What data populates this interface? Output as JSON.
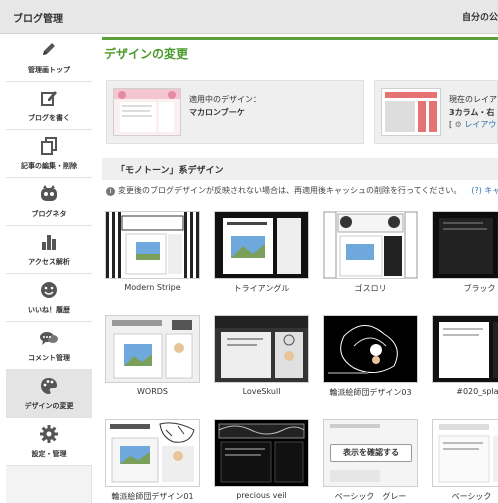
{
  "header": {
    "title": "ブログ管理",
    "right_text": "自分の公"
  },
  "sidebar": {
    "items": [
      {
        "label": "管理画トップ",
        "icon": "pencil-icon"
      },
      {
        "label": "ブログを書く",
        "icon": "write-icon"
      },
      {
        "label": "記事の編集・削除",
        "icon": "documents-icon"
      },
      {
        "label": "ブログネタ",
        "icon": "face-icon"
      },
      {
        "label": "アクセス解析",
        "icon": "bar-chart-icon"
      },
      {
        "label": "いいね！履歴",
        "icon": "smile-icon"
      },
      {
        "label": "コメント管理",
        "icon": "comment-icon"
      },
      {
        "label": "デザインの変更",
        "icon": "palette-icon"
      },
      {
        "label": "設定・管理",
        "icon": "gear-icon"
      }
    ]
  },
  "main": {
    "title": "デザインの変更",
    "current_design": {
      "label": "適用中のデザイン：",
      "name": "マカロンブーケ"
    },
    "current_layout": {
      "label": "現在のレイア",
      "value": "3カラム・右",
      "link_prefix": "[",
      "link_text": "レイアウ"
    },
    "section_title": "「モノトーン」系デザイン",
    "notice": "変更後のブログデザインが反映されない場合は、再適用後キャッシュの削除を行ってください。",
    "notice_link": "キャッ",
    "confirm_button": "表示を確認する",
    "designs": [
      {
        "name": "Modern Stripe"
      },
      {
        "name": "トライアングル"
      },
      {
        "name": "ゴスロリ"
      },
      {
        "name": "ブラック"
      },
      {
        "name": "WORDS"
      },
      {
        "name": "LoveSkull"
      },
      {
        "name": "輪派絵師団デザイン03"
      },
      {
        "name": "#020_splas"
      },
      {
        "name": "輪派絵師団デザイン01"
      },
      {
        "name": "precious veil"
      },
      {
        "name": "ベーシック　グレー"
      },
      {
        "name": "ベーシック　ブ"
      }
    ]
  },
  "colors": {
    "accent_green": "#4a9a2a",
    "link_blue": "#2a6fb0"
  }
}
